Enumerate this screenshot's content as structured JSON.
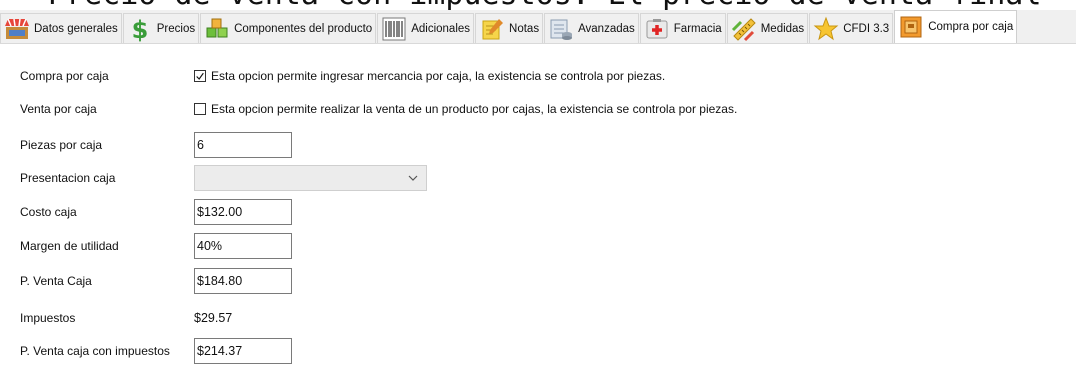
{
  "top_banner": "Precio de venta con impuestos. El precio de venta final",
  "tabs": [
    {
      "label": "Datos generales",
      "icon": "store-icon"
    },
    {
      "label": "Precios",
      "icon": "dollar-icon"
    },
    {
      "label": "Componentes del producto",
      "icon": "cubes-icon"
    },
    {
      "label": "Adicionales",
      "icon": "barcode-icon"
    },
    {
      "label": "Notas",
      "icon": "notepad-icon"
    },
    {
      "label": "Avanzadas",
      "icon": "database-icon"
    },
    {
      "label": "Farmacia",
      "icon": "first-aid-icon"
    },
    {
      "label": "Medidas",
      "icon": "ruler-icon"
    },
    {
      "label": "CFDI 3.3",
      "icon": "star-icon"
    },
    {
      "label": "Compra por caja",
      "icon": "box-icon",
      "active": true
    }
  ],
  "form": {
    "compra_por_caja": {
      "label": "Compra por caja",
      "checked": true,
      "description": "Esta opcion permite ingresar mercancia por caja, la existencia se controla por piezas."
    },
    "venta_por_caja": {
      "label": "Venta por caja",
      "checked": false,
      "description": "Esta opcion permite realizar la venta de un producto por cajas, la existencia se controla por piezas."
    },
    "piezas_por_caja": {
      "label": "Piezas por caja",
      "value": "6"
    },
    "presentacion_caja": {
      "label": "Presentacion caja",
      "value": ""
    },
    "costo_caja": {
      "label": "Costo caja",
      "value": "$132.00"
    },
    "margen_utilidad": {
      "label": "Margen de utilidad",
      "value": "40%"
    },
    "p_venta_caja": {
      "label": "P. Venta Caja",
      "value": "$184.80"
    },
    "impuestos": {
      "label": "Impuestos",
      "value": "$29.57"
    },
    "p_venta_caja_impuestos": {
      "label": "P. Venta caja con impuestos",
      "value": "$214.37"
    }
  }
}
